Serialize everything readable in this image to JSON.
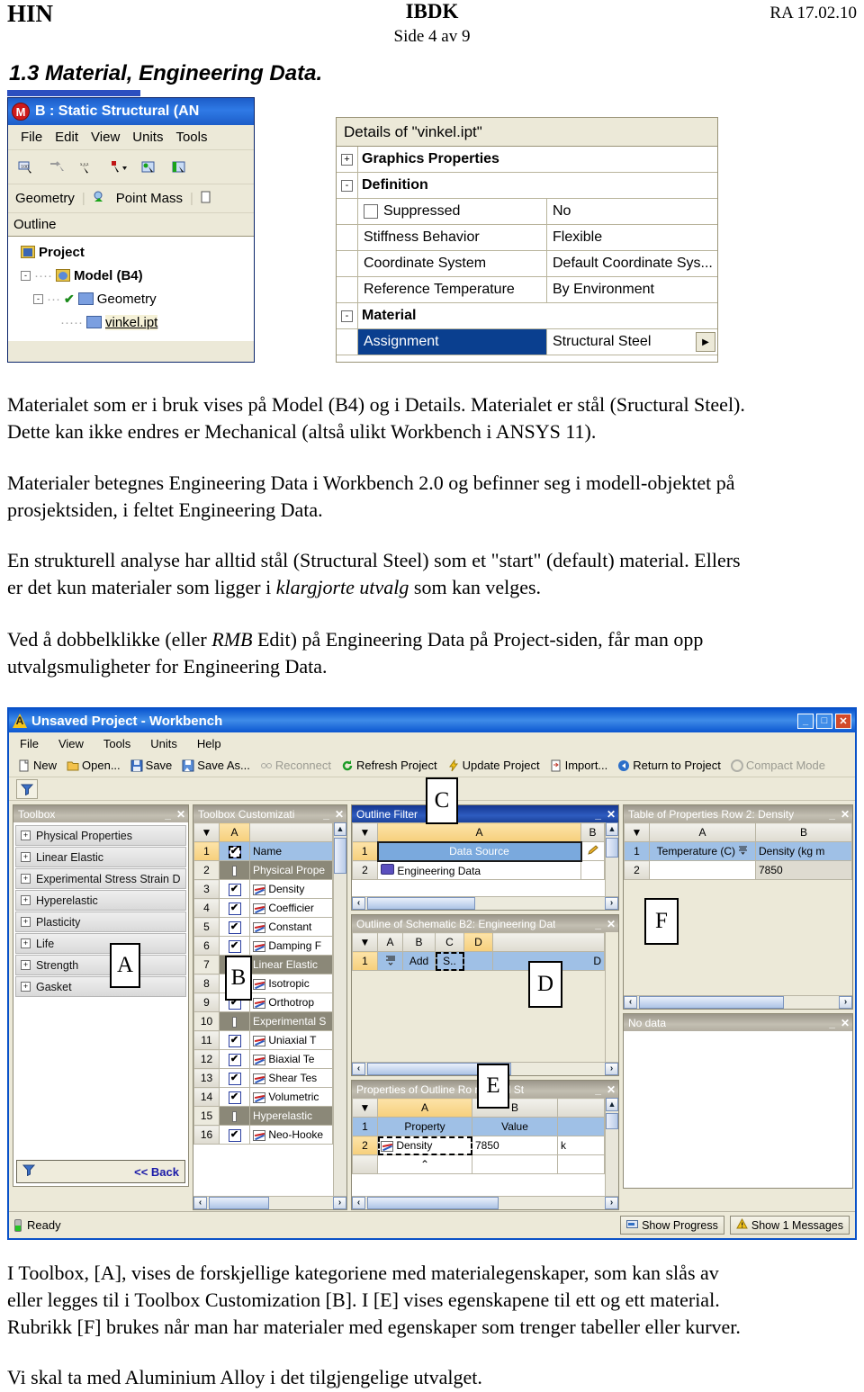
{
  "page_header": {
    "left": "HIN",
    "center": "IBDK",
    "right": "RA 17.02.10",
    "side": "Side 4 av 9"
  },
  "section": {
    "title": "1.3  Material, Engineering Data."
  },
  "mechanical_window": {
    "title": "B : Static Structural (AN",
    "logo": "M",
    "menu": [
      "File",
      "Edit",
      "View",
      "Units",
      "Tools"
    ],
    "toolbar_icons": [
      "select-body-icon",
      "extend-selection-icon",
      "coordinates-icon",
      "cursor-mode-icon",
      "body-select-icon",
      "face-select-icon"
    ],
    "toolbar2": [
      "Geometry",
      "Point Mass"
    ],
    "outline_header": "Outline",
    "tree": [
      {
        "label": "Project",
        "indent": 0,
        "expander": "",
        "icon": "project-folder-icon",
        "check": false,
        "bold": true
      },
      {
        "label": "Model (B4)",
        "indent": 1,
        "expander": "-",
        "icon": "model-icon",
        "check": false,
        "bold": true
      },
      {
        "label": "Geometry",
        "indent": 2,
        "expander": "-",
        "icon": "geometry-icon",
        "check": true,
        "bold": false
      },
      {
        "label": "vinkel.ipt",
        "indent": 3,
        "expander": "",
        "icon": "part-icon",
        "check": true,
        "bold": false,
        "highlight": true
      }
    ]
  },
  "details_window": {
    "title": "Details of \"vinkel.ipt\"",
    "rows": [
      {
        "type": "category",
        "expander": "+",
        "label": "Graphics Properties"
      },
      {
        "type": "category",
        "expander": "-",
        "label": "Definition"
      },
      {
        "type": "prop",
        "key": "Suppressed",
        "value": "No",
        "checkbox": true
      },
      {
        "type": "prop",
        "key": "Stiffness Behavior",
        "value": "Flexible"
      },
      {
        "type": "prop",
        "key": "Coordinate System",
        "value": "Default Coordinate Sys..."
      },
      {
        "type": "prop",
        "key": "Reference Temperature",
        "value": "By Environment"
      },
      {
        "type": "category",
        "expander": "-",
        "label": "Material"
      },
      {
        "type": "prop",
        "key": "Assignment",
        "value": "Structural Steel",
        "selected": true,
        "dropdown": true
      }
    ]
  },
  "paragraphs": {
    "p1_line1": "Materialet som er i bruk vises på Model (B4) og i Details. Materialet er stål (Sructural Steel).",
    "p1_line2": "Dette kan ikke endres er Mechanical (altså ulikt Workbench i ANSYS 11).",
    "p2_line1": "Materialer betegnes Engineering Data i Workbench 2.0 og befinner seg i modell-objektet på",
    "p2_line2": "prosjektsiden, i feltet Engineering Data.",
    "p3_line1": "En strukturell analyse har alltid stål (Structural Steel) som et \"start\" (default) material. Ellers",
    "p3_line2_a": "er det kun materialer som ligger i ",
    "p3_line2_i": "klargjorte utvalg",
    "p3_line2_b": " som kan velges.",
    "p4_line1_a": "Ved å dobbelklikke (eller ",
    "p4_line1_i": "RMB",
    "p4_line1_b": " Edit) på Engineering Data på Project-siden, får man opp",
    "p4_line2": "utvalgsmuligheter for Engineering Data.",
    "p5_line1": "I Toolbox, [A], vises de forskjellige kategoriene med materialegenskaper, som kan slås av",
    "p5_line2": "eller legges til i Toolbox Customization [B]. I [E] vises egenskapene til ett og ett material.",
    "p5_line3": "Rubrikk [F] brukes når man har materialer med egenskaper som trenger tabeller eller kurver.",
    "p6_line1": "Vi skal ta med Aluminium Alloy i det tilgjengelige utvalget."
  },
  "workbench": {
    "title": "Unsaved Project - Workbench",
    "window_buttons": [
      "minimize",
      "maximize",
      "close"
    ],
    "window_button_glyphs": [
      "_",
      "□",
      "✕"
    ],
    "menu": [
      "File",
      "View",
      "Tools",
      "Units",
      "Help"
    ],
    "toolbar": [
      {
        "label": "New",
        "icon": "new-document-icon",
        "enabled": true
      },
      {
        "label": "Open...",
        "icon": "open-folder-icon",
        "enabled": true
      },
      {
        "label": "Save",
        "icon": "save-disk-icon",
        "enabled": true
      },
      {
        "label": "Save As...",
        "icon": "save-as-icon",
        "enabled": true
      },
      {
        "label": "Reconnect",
        "icon": "reconnect-icon",
        "enabled": false
      },
      {
        "label": "Refresh Project",
        "icon": "refresh-icon",
        "enabled": true
      },
      {
        "label": "Update Project",
        "icon": "update-lightning-icon",
        "enabled": true
      },
      {
        "label": "Import...",
        "icon": "import-icon",
        "enabled": true
      },
      {
        "label": "Return to Project",
        "icon": "return-arrow-icon",
        "enabled": true
      },
      {
        "label": "Compact Mode",
        "icon": "compact-mode-icon",
        "enabled": false
      }
    ],
    "filter_button_icon": "filter-funnel-icon",
    "toolbox": {
      "title": "Toolbox",
      "items": [
        "Physical Properties",
        "Linear Elastic",
        "Experimental Stress Strain D",
        "Hyperelastic",
        "Plasticity",
        "Life",
        "Strength",
        "Gasket"
      ],
      "back_label": "<< Back",
      "filter_icon": "filter-funnel-icon"
    },
    "toolbox_customization": {
      "title": "Toolbox Customizati",
      "columns": [
        "",
        "A",
        ""
      ],
      "rows": [
        {
          "n": "1",
          "kind": "item",
          "checked": true,
          "label": "Name",
          "selected": true,
          "icon": ""
        },
        {
          "n": "2",
          "kind": "group",
          "label": "Physical Prope"
        },
        {
          "n": "3",
          "kind": "item",
          "checked": true,
          "label": "Density",
          "icon": "chart-icon"
        },
        {
          "n": "4",
          "kind": "item",
          "checked": true,
          "label": "Coefficier",
          "icon": "chart-icon"
        },
        {
          "n": "5",
          "kind": "item",
          "checked": true,
          "label": "Constant",
          "icon": "chart-icon"
        },
        {
          "n": "6",
          "kind": "item",
          "checked": true,
          "label": "Damping F",
          "icon": "chart-icon"
        },
        {
          "n": "7",
          "kind": "group",
          "label": "Linear Elastic"
        },
        {
          "n": "8",
          "kind": "item",
          "checked": true,
          "label": "Isotropic ",
          "icon": "chart-icon"
        },
        {
          "n": "9",
          "kind": "item",
          "checked": true,
          "label": "Orthotrop",
          "icon": "chart-icon"
        },
        {
          "n": "10",
          "kind": "group",
          "label": "Experimental S"
        },
        {
          "n": "11",
          "kind": "item",
          "checked": true,
          "label": "Uniaxial T",
          "icon": "chart-icon"
        },
        {
          "n": "12",
          "kind": "item",
          "checked": true,
          "label": "Biaxial Te",
          "icon": "chart-icon"
        },
        {
          "n": "13",
          "kind": "item",
          "checked": true,
          "label": "Shear Tes",
          "icon": "chart-icon"
        },
        {
          "n": "14",
          "kind": "item",
          "checked": true,
          "label": "Volumetric",
          "icon": "chart-icon"
        },
        {
          "n": "15",
          "kind": "group",
          "label": "Hyperelastic"
        },
        {
          "n": "16",
          "kind": "item",
          "checked": true,
          "label": "Neo-Hooke",
          "icon": "chart-icon"
        }
      ]
    },
    "outline_filter": {
      "title": "Outline Filter",
      "columns": [
        "",
        "A",
        "B"
      ],
      "rows": [
        {
          "n": "1",
          "a": "Data Source",
          "b_icon": "pencil-icon",
          "selected": true
        },
        {
          "n": "2",
          "a": "Engineering Data",
          "icon": "book-icon"
        }
      ]
    },
    "outline_schematic": {
      "title": "Outline of Schematic B2: Engineering Dat",
      "columns": [
        "",
        "A",
        "B",
        "C",
        "D",
        ""
      ],
      "active_column": "D",
      "rows": [
        {
          "n": "1",
          "a_icon": "add-row-icon",
          "b": "Add",
          "c": "S..",
          "d": "D",
          "selected": true
        }
      ]
    },
    "properties_outline": {
      "title": "Properties of Outline Ro              ructural St",
      "columns": [
        "",
        "A",
        "B",
        ""
      ],
      "rows": [
        {
          "n": "1",
          "a": "Property",
          "b": "Value",
          "header_row": true
        },
        {
          "n": "2",
          "a": "Density",
          "a_icon": "chart-icon",
          "b": "7850",
          "c": "k",
          "dashed": true
        }
      ]
    },
    "table_of_properties": {
      "title": "Table of Properties Row 2: Density",
      "columns": [
        "",
        "A",
        "B"
      ],
      "rows": [
        {
          "n": "1",
          "a": "Temperature (C)",
          "a_icon": "sort-icon",
          "b": "Density (kg m",
          "header_row": true
        },
        {
          "n": "2",
          "a": "",
          "b": "7850"
        }
      ]
    },
    "no_data_panel": {
      "title": "No data"
    },
    "status_bar": {
      "status": "Ready",
      "buttons": [
        {
          "label": "Show Progress",
          "icon": "progress-icon"
        },
        {
          "label": "Show 1 Messages",
          "icon": "warning-icon"
        }
      ]
    },
    "callouts": [
      "A",
      "B",
      "C",
      "D",
      "E",
      "F"
    ]
  }
}
